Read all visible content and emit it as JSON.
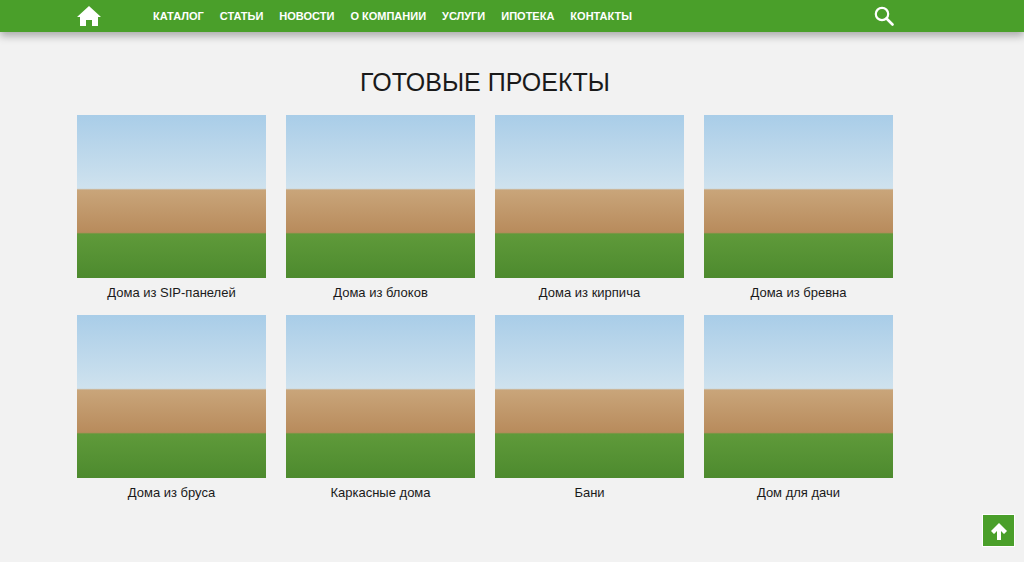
{
  "header": {
    "nav": [
      "КАТАЛОГ",
      "СТАТЬИ",
      "НОВОСТИ",
      "О КОМПАНИИ",
      "УСЛУГИ",
      "ИПОТЕКА",
      "КОНТАКТЫ"
    ]
  },
  "section": {
    "title": "ГОТОВЫЕ ПРОЕКТЫ"
  },
  "projects": [
    {
      "name": "Дома из SIP-панелей"
    },
    {
      "name": "Дома из блоков"
    },
    {
      "name": "Дома из кирпича"
    },
    {
      "name": "Дома из бревна"
    },
    {
      "name": "Дома из бруса"
    },
    {
      "name": "Каркасные дома"
    },
    {
      "name": "Бани"
    },
    {
      "name": "Дом для дачи"
    }
  ]
}
